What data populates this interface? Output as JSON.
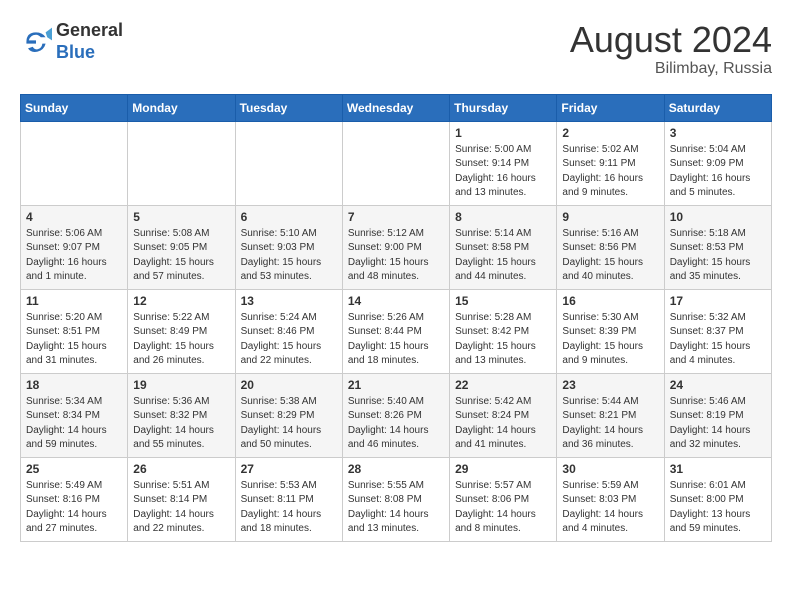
{
  "header": {
    "logo_line1": "General",
    "logo_line2": "Blue",
    "title": "August 2024",
    "subtitle": "Bilimbay, Russia"
  },
  "weekdays": [
    "Sunday",
    "Monday",
    "Tuesday",
    "Wednesday",
    "Thursday",
    "Friday",
    "Saturday"
  ],
  "weeks": [
    [
      {
        "day": "",
        "info": ""
      },
      {
        "day": "",
        "info": ""
      },
      {
        "day": "",
        "info": ""
      },
      {
        "day": "",
        "info": ""
      },
      {
        "day": "1",
        "info": "Sunrise: 5:00 AM\nSunset: 9:14 PM\nDaylight: 16 hours\nand 13 minutes."
      },
      {
        "day": "2",
        "info": "Sunrise: 5:02 AM\nSunset: 9:11 PM\nDaylight: 16 hours\nand 9 minutes."
      },
      {
        "day": "3",
        "info": "Sunrise: 5:04 AM\nSunset: 9:09 PM\nDaylight: 16 hours\nand 5 minutes."
      }
    ],
    [
      {
        "day": "4",
        "info": "Sunrise: 5:06 AM\nSunset: 9:07 PM\nDaylight: 16 hours\nand 1 minute."
      },
      {
        "day": "5",
        "info": "Sunrise: 5:08 AM\nSunset: 9:05 PM\nDaylight: 15 hours\nand 57 minutes."
      },
      {
        "day": "6",
        "info": "Sunrise: 5:10 AM\nSunset: 9:03 PM\nDaylight: 15 hours\nand 53 minutes."
      },
      {
        "day": "7",
        "info": "Sunrise: 5:12 AM\nSunset: 9:00 PM\nDaylight: 15 hours\nand 48 minutes."
      },
      {
        "day": "8",
        "info": "Sunrise: 5:14 AM\nSunset: 8:58 PM\nDaylight: 15 hours\nand 44 minutes."
      },
      {
        "day": "9",
        "info": "Sunrise: 5:16 AM\nSunset: 8:56 PM\nDaylight: 15 hours\nand 40 minutes."
      },
      {
        "day": "10",
        "info": "Sunrise: 5:18 AM\nSunset: 8:53 PM\nDaylight: 15 hours\nand 35 minutes."
      }
    ],
    [
      {
        "day": "11",
        "info": "Sunrise: 5:20 AM\nSunset: 8:51 PM\nDaylight: 15 hours\nand 31 minutes."
      },
      {
        "day": "12",
        "info": "Sunrise: 5:22 AM\nSunset: 8:49 PM\nDaylight: 15 hours\nand 26 minutes."
      },
      {
        "day": "13",
        "info": "Sunrise: 5:24 AM\nSunset: 8:46 PM\nDaylight: 15 hours\nand 22 minutes."
      },
      {
        "day": "14",
        "info": "Sunrise: 5:26 AM\nSunset: 8:44 PM\nDaylight: 15 hours\nand 18 minutes."
      },
      {
        "day": "15",
        "info": "Sunrise: 5:28 AM\nSunset: 8:42 PM\nDaylight: 15 hours\nand 13 minutes."
      },
      {
        "day": "16",
        "info": "Sunrise: 5:30 AM\nSunset: 8:39 PM\nDaylight: 15 hours\nand 9 minutes."
      },
      {
        "day": "17",
        "info": "Sunrise: 5:32 AM\nSunset: 8:37 PM\nDaylight: 15 hours\nand 4 minutes."
      }
    ],
    [
      {
        "day": "18",
        "info": "Sunrise: 5:34 AM\nSunset: 8:34 PM\nDaylight: 14 hours\nand 59 minutes."
      },
      {
        "day": "19",
        "info": "Sunrise: 5:36 AM\nSunset: 8:32 PM\nDaylight: 14 hours\nand 55 minutes."
      },
      {
        "day": "20",
        "info": "Sunrise: 5:38 AM\nSunset: 8:29 PM\nDaylight: 14 hours\nand 50 minutes."
      },
      {
        "day": "21",
        "info": "Sunrise: 5:40 AM\nSunset: 8:26 PM\nDaylight: 14 hours\nand 46 minutes."
      },
      {
        "day": "22",
        "info": "Sunrise: 5:42 AM\nSunset: 8:24 PM\nDaylight: 14 hours\nand 41 minutes."
      },
      {
        "day": "23",
        "info": "Sunrise: 5:44 AM\nSunset: 8:21 PM\nDaylight: 14 hours\nand 36 minutes."
      },
      {
        "day": "24",
        "info": "Sunrise: 5:46 AM\nSunset: 8:19 PM\nDaylight: 14 hours\nand 32 minutes."
      }
    ],
    [
      {
        "day": "25",
        "info": "Sunrise: 5:49 AM\nSunset: 8:16 PM\nDaylight: 14 hours\nand 27 minutes."
      },
      {
        "day": "26",
        "info": "Sunrise: 5:51 AM\nSunset: 8:14 PM\nDaylight: 14 hours\nand 22 minutes."
      },
      {
        "day": "27",
        "info": "Sunrise: 5:53 AM\nSunset: 8:11 PM\nDaylight: 14 hours\nand 18 minutes."
      },
      {
        "day": "28",
        "info": "Sunrise: 5:55 AM\nSunset: 8:08 PM\nDaylight: 14 hours\nand 13 minutes."
      },
      {
        "day": "29",
        "info": "Sunrise: 5:57 AM\nSunset: 8:06 PM\nDaylight: 14 hours\nand 8 minutes."
      },
      {
        "day": "30",
        "info": "Sunrise: 5:59 AM\nSunset: 8:03 PM\nDaylight: 14 hours\nand 4 minutes."
      },
      {
        "day": "31",
        "info": "Sunrise: 6:01 AM\nSunset: 8:00 PM\nDaylight: 13 hours\nand 59 minutes."
      }
    ]
  ]
}
